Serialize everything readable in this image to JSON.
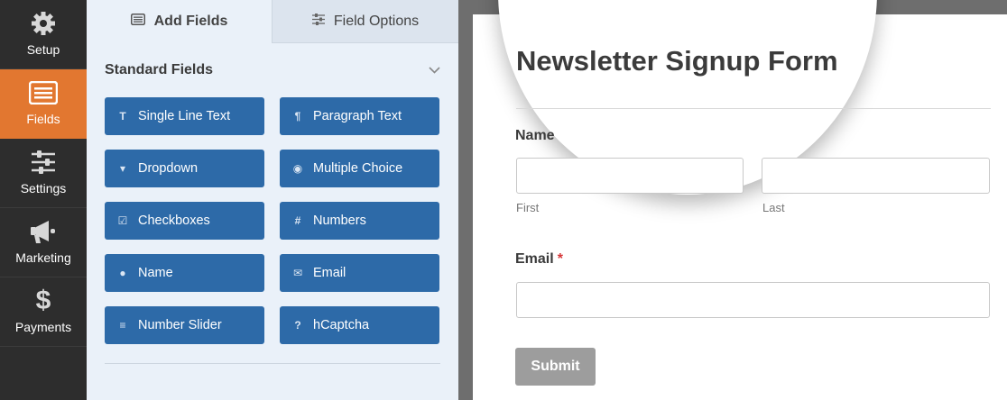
{
  "nav": {
    "items": [
      {
        "label": "Setup",
        "icon": "gear-icon"
      },
      {
        "label": "Fields",
        "icon": "list-icon",
        "active": true
      },
      {
        "label": "Settings",
        "icon": "sliders-icon"
      },
      {
        "label": "Marketing",
        "icon": "megaphone-icon"
      },
      {
        "label": "Payments",
        "icon": "dollar-icon"
      }
    ]
  },
  "panel": {
    "tabs": [
      {
        "label": "Add Fields",
        "active": true
      },
      {
        "label": "Field Options",
        "active": false
      }
    ],
    "section_title": "Standard Fields",
    "fields": [
      {
        "label": "Single Line Text",
        "icon": "text-icon",
        "glyph": "T"
      },
      {
        "label": "Paragraph Text",
        "icon": "paragraph-icon",
        "glyph": "¶"
      },
      {
        "label": "Dropdown",
        "icon": "dropdown-icon",
        "glyph": "▾"
      },
      {
        "label": "Multiple Choice",
        "icon": "radio-icon",
        "glyph": "◉"
      },
      {
        "label": "Checkboxes",
        "icon": "checkbox-icon",
        "glyph": "☑"
      },
      {
        "label": "Numbers",
        "icon": "hash-icon",
        "glyph": "#"
      },
      {
        "label": "Name",
        "icon": "person-icon",
        "glyph": "●"
      },
      {
        "label": "Email",
        "icon": "envelope-icon",
        "glyph": "✉"
      },
      {
        "label": "Number Slider",
        "icon": "slider-icon",
        "glyph": "≡"
      },
      {
        "label": "hCaptcha",
        "icon": "question-icon",
        "glyph": "?"
      }
    ]
  },
  "form": {
    "title": "Newsletter Signup Form",
    "name_label": "Name",
    "first_sublabel": "First",
    "last_sublabel": "Last",
    "email_label": "Email",
    "required_mark": "*",
    "submit_label": "Submit"
  },
  "colors": {
    "sidebar": "#2d2d2d",
    "accent": "#e27730",
    "field_button": "#2d6aa8",
    "panel_bg": "#eaf1f9",
    "submit": "#9d9d9d"
  }
}
